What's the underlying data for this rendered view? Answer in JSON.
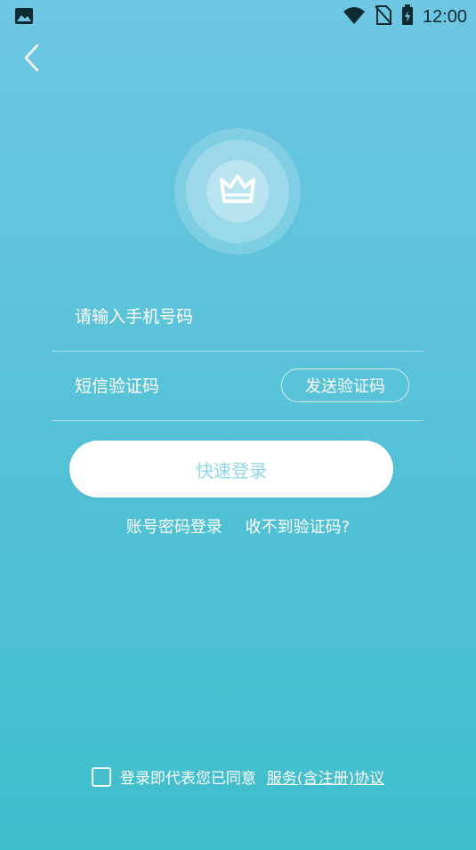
{
  "statusbar": {
    "time": "12:00"
  },
  "form": {
    "phone_placeholder": "请输入手机号码",
    "code_placeholder": "短信验证码",
    "send_code_label": "发送验证码",
    "login_label": "快速登录"
  },
  "links": {
    "password_login": "账号密码登录",
    "no_code": "收不到验证码?"
  },
  "agreement": {
    "text": "登录即代表您已同意",
    "link": "服务(含注册)协议"
  }
}
